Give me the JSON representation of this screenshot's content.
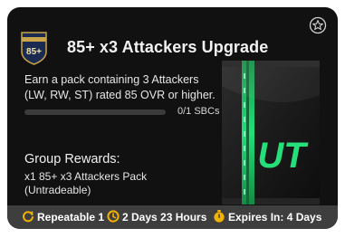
{
  "objective": {
    "title": "85+ x3 Attackers Upgrade",
    "badge_text": "85+",
    "description": "Earn a pack containing 3 Attackers (LW, RW, ST) rated 85 OVR or higher.",
    "progress": {
      "label": "0/1 SBCs",
      "completed": 0,
      "total": 1
    }
  },
  "rewards": {
    "heading": "Group Rewards:",
    "item": "x1 85+ x3 Attackers Pack (Untradeable)",
    "pack_logo_text": "UT"
  },
  "footer": {
    "repeatable": "Repeatable 1",
    "time_left": "2 Days 23 Hours",
    "expires": "Expires In: 4 Days"
  },
  "colors": {
    "card_bg": "#111111",
    "footer_bg": "#3e3e3e",
    "accent_green": "#1fd36b",
    "icon_gold": "#f2b200"
  },
  "icons": [
    "shield-badge-icon",
    "star-circle-icon",
    "repeat-icon",
    "timer-icon",
    "stopwatch-icon"
  ]
}
